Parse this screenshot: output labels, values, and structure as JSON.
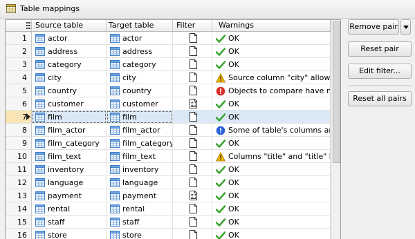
{
  "panel": {
    "title": "Table mappings"
  },
  "columns": {
    "source": "Source table",
    "target": "Target table",
    "filter": "Filter",
    "warnings": "Warnings"
  },
  "rows": [
    {
      "n": "1",
      "source": "actor",
      "target": "actor",
      "filter": "empty",
      "warning_icon": "ok-check-icon",
      "warning": "OK"
    },
    {
      "n": "2",
      "source": "address",
      "target": "address",
      "filter": "empty",
      "warning_icon": "ok-check-icon",
      "warning": "OK"
    },
    {
      "n": "3",
      "source": "category",
      "target": "category",
      "filter": "empty",
      "warning_icon": "ok-check-icon",
      "warning": "OK"
    },
    {
      "n": "4",
      "source": "city",
      "target": "city",
      "filter": "empty",
      "warning_icon": "warning-triangle-icon",
      "warning": "Source column \"city\" allows Nu"
    },
    {
      "n": "5",
      "source": "country",
      "target": "country",
      "filter": "empty",
      "warning_icon": "error-icon",
      "warning": "Objects to compare have no ke"
    },
    {
      "n": "6",
      "source": "customer",
      "target": "customer",
      "filter": "set",
      "warning_icon": "ok-check-icon",
      "warning": "OK"
    },
    {
      "n": "7",
      "source": "film",
      "target": "film",
      "filter": "empty",
      "warning_icon": "ok-check-icon",
      "warning": "OK",
      "selected": true
    },
    {
      "n": "8",
      "source": "film_actor",
      "target": "film_actor",
      "filter": "empty",
      "warning_icon": "info-icon",
      "warning": "Some of table's columns are no"
    },
    {
      "n": "9",
      "source": "film_category",
      "target": "film_category",
      "filter": "empty",
      "warning_icon": "ok-check-icon",
      "warning": "OK"
    },
    {
      "n": "10",
      "source": "film_text",
      "target": "film_text",
      "filter": "empty",
      "warning_icon": "warning-triangle-icon",
      "warning": "Columns \"title\" and \"title\" have"
    },
    {
      "n": "11",
      "source": "inventory",
      "target": "inventory",
      "filter": "empty",
      "warning_icon": "ok-check-icon",
      "warning": "OK"
    },
    {
      "n": "12",
      "source": "language",
      "target": "language",
      "filter": "empty",
      "warning_icon": "ok-check-icon",
      "warning": "OK"
    },
    {
      "n": "13",
      "source": "payment",
      "target": "payment",
      "filter": "set",
      "warning_icon": "ok-check-icon",
      "warning": "OK"
    },
    {
      "n": "14",
      "source": "rental",
      "target": "rental",
      "filter": "empty",
      "warning_icon": "ok-check-icon",
      "warning": "OK"
    },
    {
      "n": "15",
      "source": "staff",
      "target": "staff",
      "filter": "empty",
      "warning_icon": "ok-check-icon",
      "warning": "OK"
    },
    {
      "n": "16",
      "source": "store",
      "target": "store",
      "filter": "empty",
      "warning_icon": "ok-check-icon",
      "warning": "OK"
    }
  ],
  "buttons": {
    "remove_pair": "Remove pair",
    "reset_pair": "Reset pair",
    "edit_filter": "Edit filter...",
    "reset_all_pairs": "Reset all pairs"
  },
  "colors": {
    "selected_row": "#dbe9f7",
    "ok": "#3aa52f",
    "warning": "#f0b400",
    "error": "#d9312a",
    "info": "#2a5fd9",
    "table_icon": "#3d7dc9"
  }
}
